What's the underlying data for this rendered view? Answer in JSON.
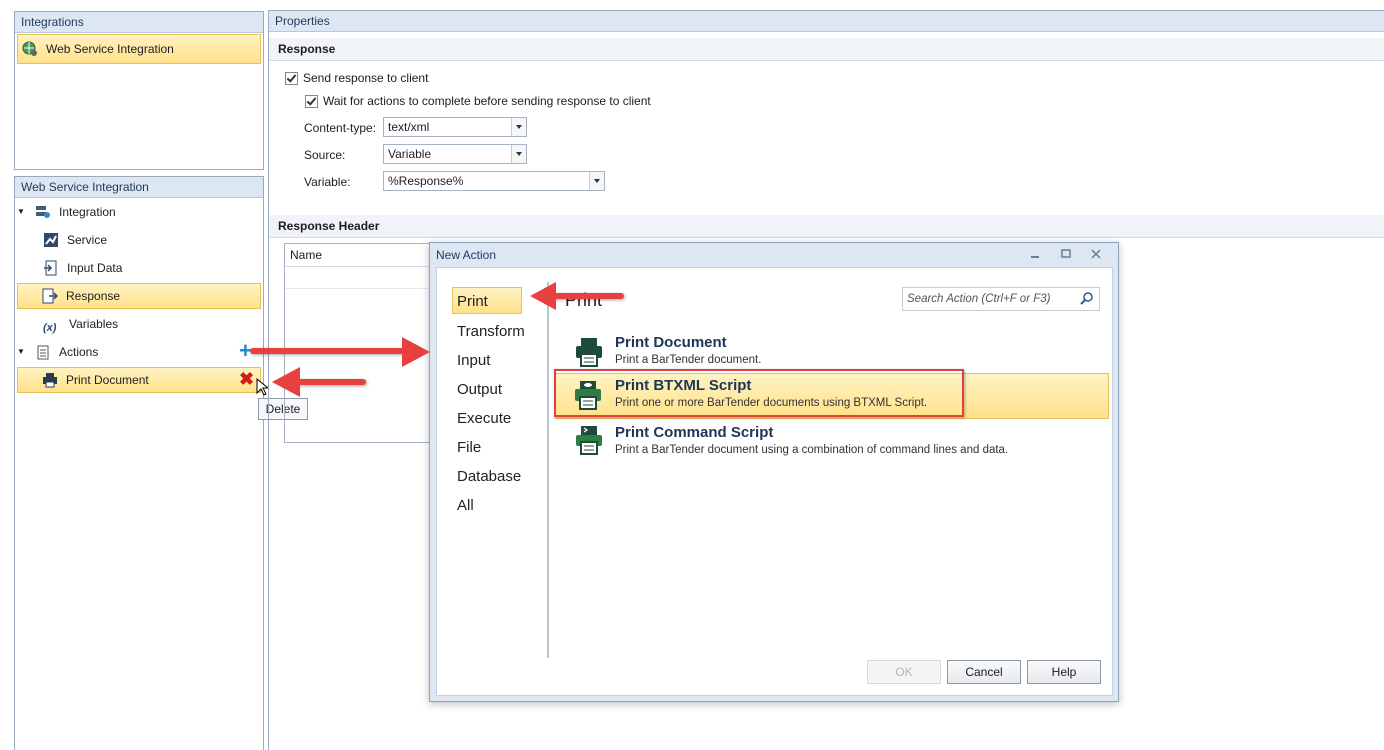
{
  "integrations_panel": {
    "header": "Integrations",
    "item": "Web Service Integration"
  },
  "tree_panel": {
    "header": "Web Service Integration",
    "items": [
      {
        "label": "Integration"
      },
      {
        "label": "Service"
      },
      {
        "label": "Input Data"
      },
      {
        "label": "Response"
      },
      {
        "label": "Variables"
      },
      {
        "label": "Actions"
      },
      {
        "label": "Print Document"
      }
    ],
    "tooltip": "Delete"
  },
  "properties": {
    "header": "Properties",
    "response_section": "Response",
    "send_response_label": "Send response to client",
    "wait_label": "Wait for actions to complete before sending response to client",
    "content_type_label": "Content-type:",
    "content_type_value": "text/xml",
    "source_label": "Source:",
    "source_value": "Variable",
    "variable_label": "Variable:",
    "variable_value": "%Response%",
    "response_header_section": "Response Header",
    "grid_col_name": "Name"
  },
  "dialog": {
    "title": "New Action",
    "categories": [
      "Print",
      "Transform",
      "Input",
      "Output",
      "Execute",
      "File",
      "Database",
      "All"
    ],
    "group_title": "Print",
    "search_placeholder": "Search Action (Ctrl+F or F3)",
    "actions": [
      {
        "title": "Print Document",
        "desc": "Print a BarTender document."
      },
      {
        "title": "Print BTXML Script",
        "desc": "Print one or more BarTender documents using BTXML Script."
      },
      {
        "title": "Print Command Script",
        "desc": "Print a BarTender document using a combination of command lines and data."
      }
    ],
    "ok": "OK",
    "cancel": "Cancel",
    "help": "Help"
  },
  "colors": {
    "accent_red": "#e8403f",
    "selection": "#ffe18a",
    "header_blue": "#dde7f3"
  }
}
